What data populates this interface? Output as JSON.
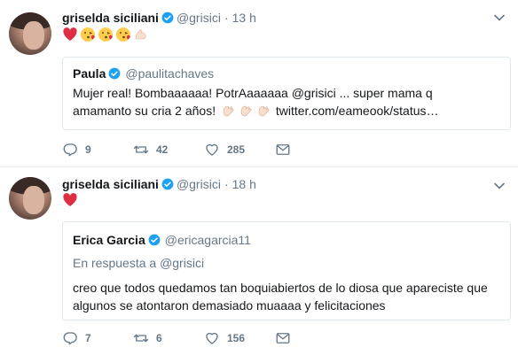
{
  "tweets": [
    {
      "author": {
        "name": "griselda siciliani",
        "handle": "@grisici",
        "time": "13 h",
        "verified": true
      },
      "text_emojis": [
        "red-heart",
        "kissing-face",
        "kissing-face",
        "kissing-face",
        "flexed-biceps"
      ],
      "quote": {
        "name": "Paula",
        "handle": "@paulitachaves",
        "verified": true,
        "text_line1": "Mujer real! Bombaaaaaa! PotrAaaaaaa @grisici ... super mama q",
        "text_line2": "amamanto su cria 2 años!",
        "link": "twitter.com/eameook/status…"
      },
      "actions": {
        "replies": "9",
        "retweets": "42",
        "likes": "285"
      }
    },
    {
      "author": {
        "name": "griselda siciliani",
        "handle": "@grisici",
        "time": "18 h",
        "verified": true
      },
      "text_emojis": [
        "red-heart"
      ],
      "quote": {
        "name": "Erica Garcia",
        "handle": "@ericagarcia11",
        "verified": true,
        "reply_prefix": "En respuesta a",
        "reply_handle": "@grisici",
        "text_line1": "creo que todos quedamos tan boquiabiertos de lo diosa que apareciste que",
        "text_line2": "algunos se atontaron demasiado muaaaa y felicitaciones"
      },
      "actions": {
        "replies": "7",
        "retweets": "6",
        "likes": "156"
      }
    }
  ],
  "colors": {
    "verified": "#1da1f2",
    "muted": "#657786",
    "border": "#e1e8ed",
    "heart": "#dd2e44"
  }
}
